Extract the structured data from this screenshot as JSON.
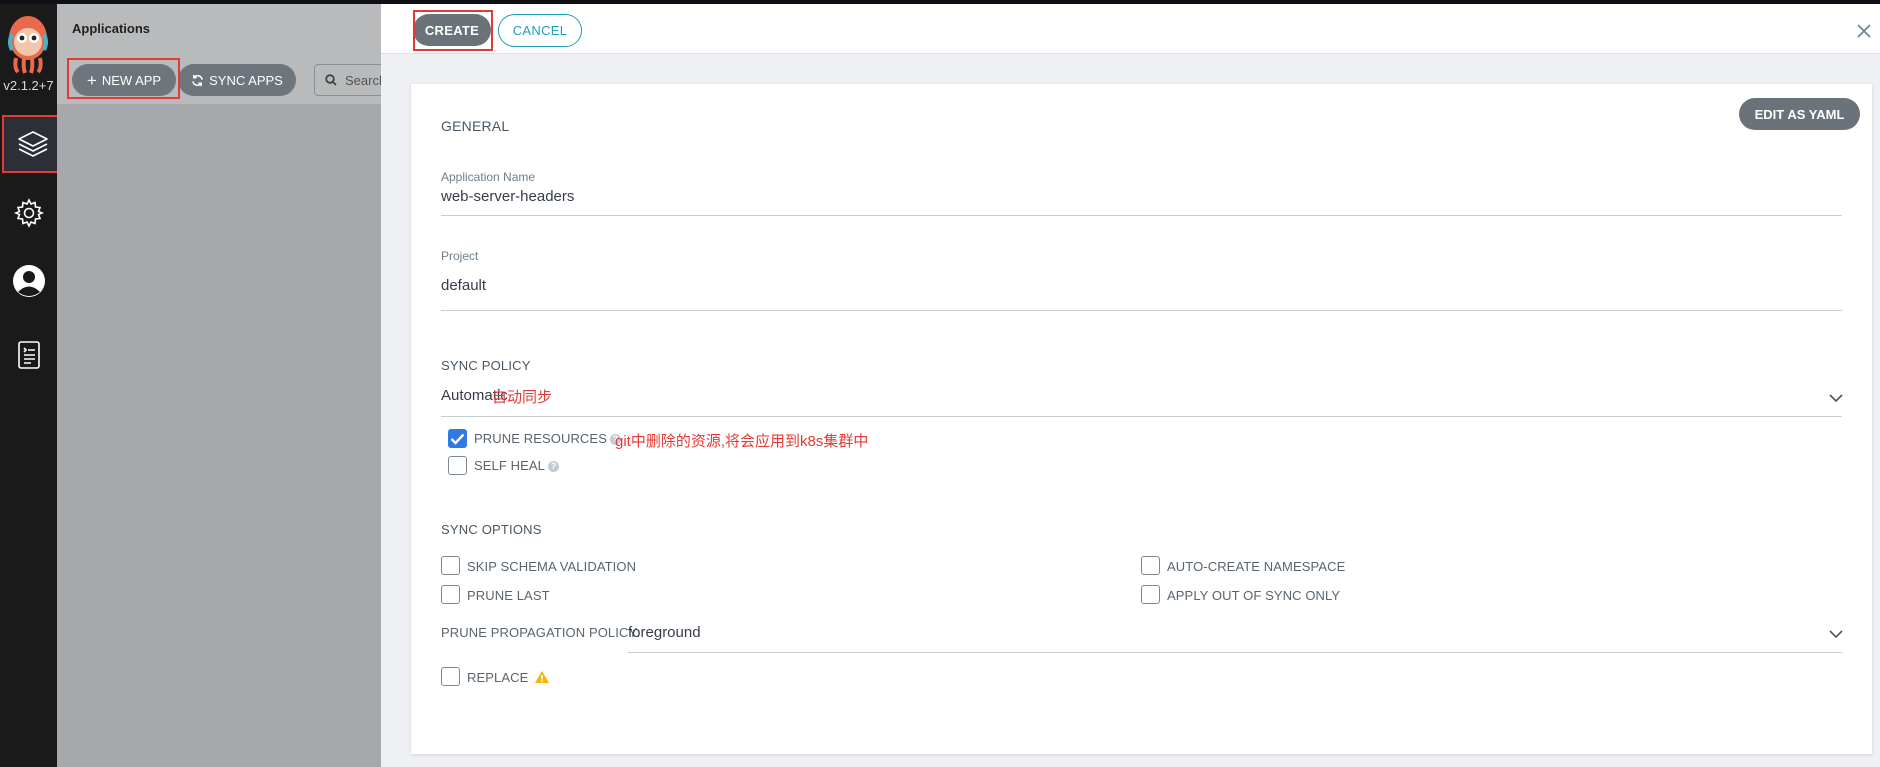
{
  "sidebar": {
    "version": "v2.1.2+7",
    "items": [
      {
        "name": "applications",
        "icon": "layers-icon"
      },
      {
        "name": "settings",
        "icon": "gear-icon"
      },
      {
        "name": "user-info",
        "icon": "user-icon"
      },
      {
        "name": "documentation",
        "icon": "docs-icon"
      }
    ]
  },
  "apps_page": {
    "title": "Applications",
    "new_app_label": "NEW APP",
    "sync_apps_label": "SYNC APPS",
    "search_placeholder": "Search"
  },
  "panel": {
    "create_label": "CREATE",
    "cancel_label": "CANCEL",
    "edit_yaml_label": "EDIT AS YAML",
    "general": {
      "title": "GENERAL",
      "app_name_label": "Application Name",
      "app_name_value": "web-server-headers",
      "project_label": "Project",
      "project_value": "default"
    },
    "sync_policy": {
      "title": "SYNC POLICY",
      "value": "Automatic",
      "annotation": "自动同步",
      "prune_resources_label": "PRUNE RESOURCES",
      "prune_resources_checked": true,
      "prune_annotation": "git中删除的资源,将会应用到k8s集群中",
      "self_heal_label": "SELF HEAL",
      "self_heal_checked": false
    },
    "sync_options": {
      "title": "SYNC OPTIONS",
      "skip_schema_label": "SKIP SCHEMA VALIDATION",
      "auto_create_ns_label": "AUTO-CREATE NAMESPACE",
      "prune_last_label": "PRUNE LAST",
      "apply_out_of_sync_label": "APPLY OUT OF SYNC ONLY",
      "prune_propagation_label": "PRUNE PROPAGATION POLICY:",
      "prune_propagation_value": "foreground",
      "replace_label": "REPLACE"
    }
  },
  "colors": {
    "accent": "#2f7ae5",
    "cancel": "#1ea1b5",
    "annotation": "#e53935",
    "warning": "#f2b705"
  }
}
